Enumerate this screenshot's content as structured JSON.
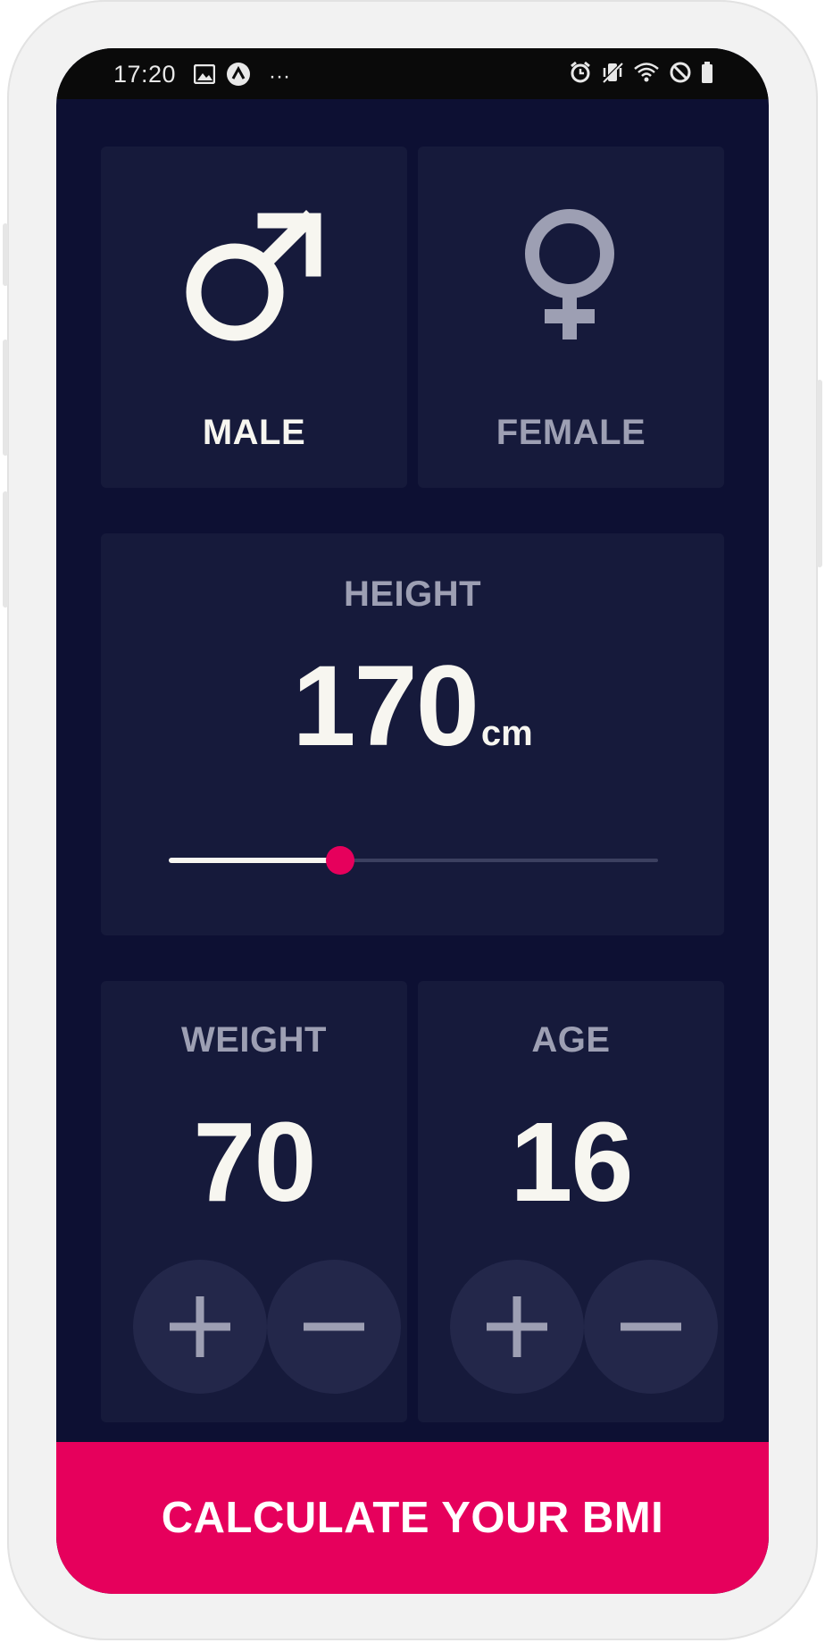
{
  "status_bar": {
    "time": "17:20",
    "left_icons": [
      "gallery-icon",
      "app-notification-icon",
      "more-notifications-icon"
    ],
    "more_text": "···",
    "right_icons": [
      "alarm-icon",
      "vibrate-icon",
      "wifi-icon",
      "do-not-disturb-icon",
      "battery-icon"
    ]
  },
  "gender": {
    "male": {
      "label": "MALE",
      "icon": "male-symbol-icon",
      "selected": true
    },
    "female": {
      "label": "FEMALE",
      "icon": "female-symbol-icon",
      "selected": false
    }
  },
  "height": {
    "label": "HEIGHT",
    "value": "170",
    "unit": "cm",
    "slider_fraction": 0.35
  },
  "weight": {
    "label": "WEIGHT",
    "value": "70",
    "increment_icon": "plus-icon",
    "decrement_icon": "minus-icon"
  },
  "age": {
    "label": "AGE",
    "value": "16",
    "increment_icon": "plus-icon",
    "decrement_icon": "minus-icon"
  },
  "calculate_button": {
    "label": "CALCULATE YOUR BMI"
  },
  "colors": {
    "background": "#0d1033",
    "card": "#161a3b",
    "accent": "#e6005c",
    "active_text": "#f7f6f0",
    "inactive_text": "#9d9fb3",
    "round_button": "#23274a"
  }
}
